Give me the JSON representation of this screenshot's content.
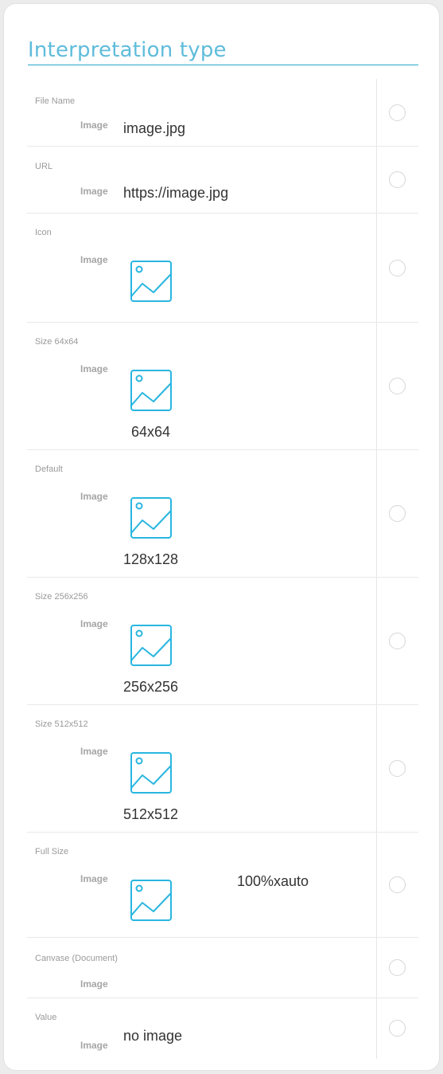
{
  "title": "Interpretation type",
  "image_label": "Image",
  "icon_color": "#29b6e0",
  "options": [
    {
      "label": "File Name",
      "value": "image.jpg",
      "has_icon": false
    },
    {
      "label": "URL",
      "value": "https://image.jpg",
      "has_icon": false
    },
    {
      "label": "Icon",
      "value": "",
      "has_icon": true
    },
    {
      "label": "Size 64x64",
      "value": "64x64",
      "has_icon": true
    },
    {
      "label": "Default",
      "value": "128x128",
      "has_icon": true
    },
    {
      "label": "Size 256x256",
      "value": "256x256",
      "has_icon": true
    },
    {
      "label": "Size 512x512",
      "value": "512x512",
      "has_icon": true
    },
    {
      "label": "Full Size",
      "value": "100%xauto",
      "has_icon": true
    },
    {
      "label": "Canvase (Document)",
      "value": "",
      "has_icon": false
    },
    {
      "label": "Value",
      "value": "no image",
      "has_icon": false
    }
  ]
}
